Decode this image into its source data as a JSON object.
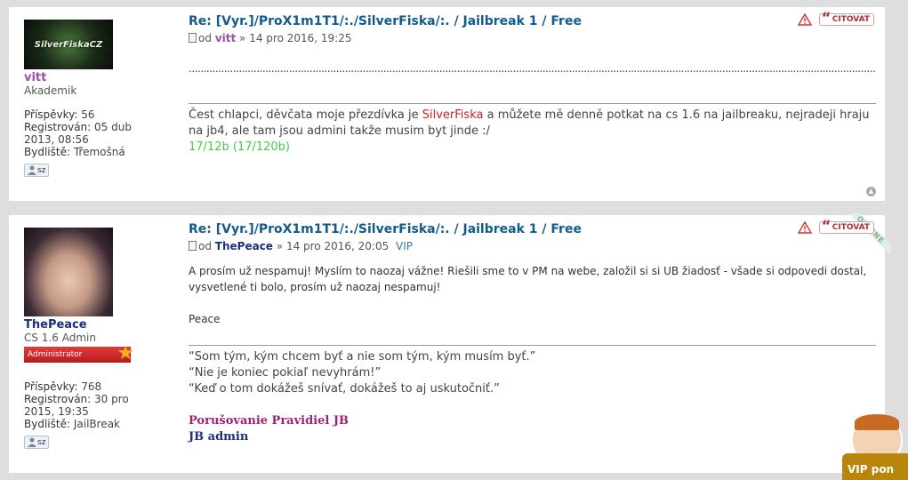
{
  "posts": [
    {
      "author": "vitt",
      "author_color": "#9b4fa8",
      "avatar_text": "SilverFiskaCZ",
      "rank": "Akademik",
      "stats": [
        {
          "key": "Příspěvky:",
          "value": "56"
        },
        {
          "key": "Registrován:",
          "value": "05 dub 2013, 08:56"
        },
        {
          "key": "Bydliště:",
          "value": "Třemošná"
        }
      ],
      "pm_label": "sz",
      "title": "Re: [Vyr.]/ProX1m1T1/:./SilverFiska/:. / Jailbreak 1 / Free",
      "meta_prefix": "od",
      "date": "» 14 pro 2016, 19:25",
      "dots": "........................................................................................................................................................................................................................................................................................................................................................................................................................",
      "sig_pre": "Čest chlapci, děvčata moje přezdívka je ",
      "sig_name": "SilverFiska",
      "sig_post": " a můžete mě denně potkat na cs 1.6 na jailbreaku, nejradeji hraju na jb4, ale tam jsou admini takže musim byt jinde :/",
      "sig_stat": "17/12b (17/120b)"
    },
    {
      "author": "ThePeace",
      "author_color": "#1b2f80",
      "rank": "CS 1.6 Admin",
      "badge": "Administrator",
      "online": "ONLINE",
      "stats": [
        {
          "key": "Příspěvky:",
          "value": "768"
        },
        {
          "key": "Registrován:",
          "value": "30 pro 2015, 19:35"
        },
        {
          "key": "Bydliště:",
          "value": "JailBreak"
        }
      ],
      "pm_label": "sz",
      "title": "Re: [Vyr.]/ProX1m1T1/:./SilverFiska/:. / Jailbreak 1 / Free",
      "meta_prefix": "od",
      "date": "» 14 pro 2016, 20:05",
      "vip": "VIP",
      "body_lines": [
        "A prosím už nespamuj! Myslím to naozaj vážne! Riešili sme to v PM na webe, založil si si UB žiadosť - všade si odpovedi dostal, vysvetlené ti bolo, prosím už naozaj nespamuj!",
        "Peace"
      ],
      "quotes": [
        "“Som tým, kým chcem byť a nie som tým, kým musím byť.”",
        "“Nie je koniec pokiaľ nevyhrám!”",
        "“Keď o tom dokážeš snívať, dokážeš to aj uskutočniť.”"
      ],
      "sig_role1": "Porušovanie Pravidiel JB",
      "sig_role2": "JB admin"
    }
  ],
  "quote_label": "CITOVAT",
  "widget_label": "VIP pon",
  "colors": {
    "role1": "#a0207a",
    "role2": "#1b2f80"
  }
}
